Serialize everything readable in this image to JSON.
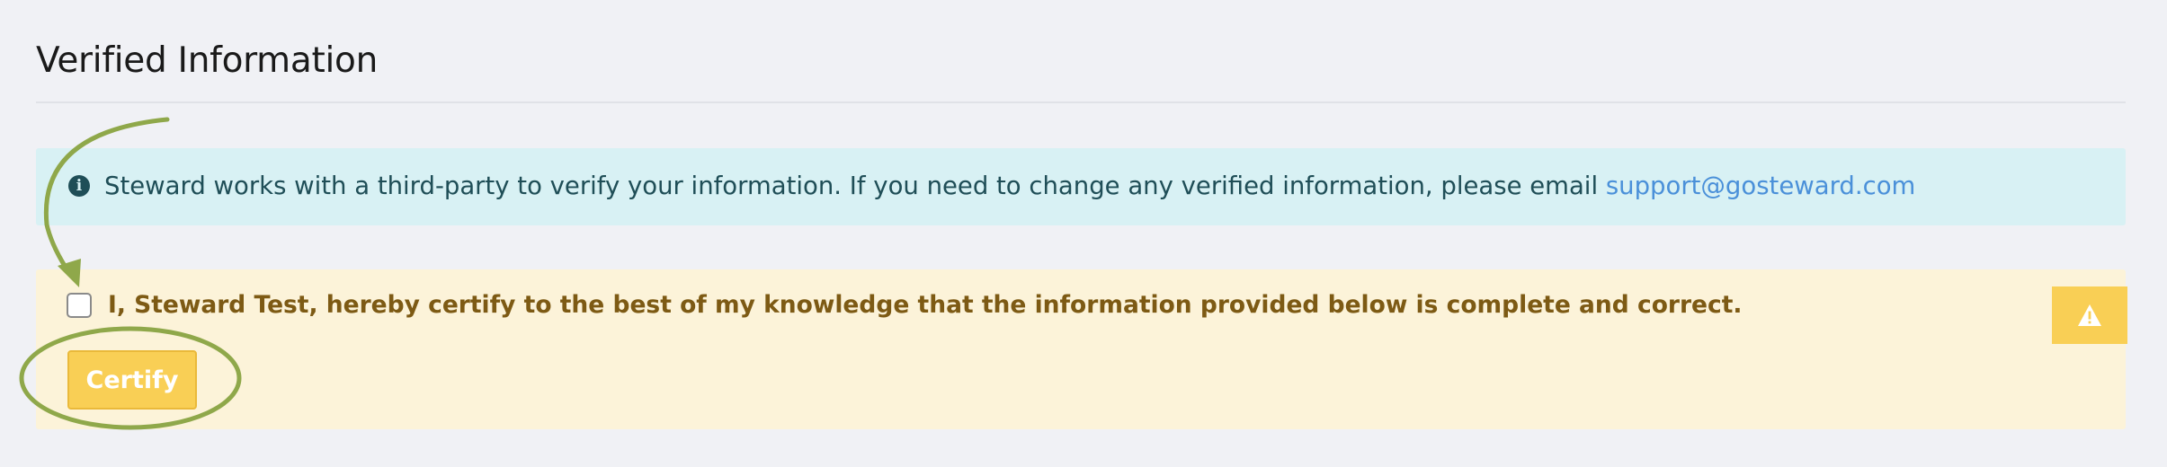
{
  "page": {
    "title": "Verified Information"
  },
  "info_alert": {
    "icon": "info-circle-icon",
    "message": "Steward works with a third-party to verify your information. If you need to change any verified information, please email ",
    "link_text": "support@gosteward.com",
    "color": "#1f4e57",
    "background": "#d8f1f4",
    "link_color": "#4a90d9"
  },
  "certify_alert": {
    "checkbox_checked": false,
    "statement": "I, Steward Test, hereby certify to the best of my knowledge that the information provided below is complete and correct.",
    "button_label": "Certify",
    "badge_icon": "warning-triangle-icon",
    "text_color": "#7d5a14",
    "background": "#fcf3d9",
    "accent": "#f9cf55"
  },
  "annotations": {
    "color": "#8fa84a"
  }
}
